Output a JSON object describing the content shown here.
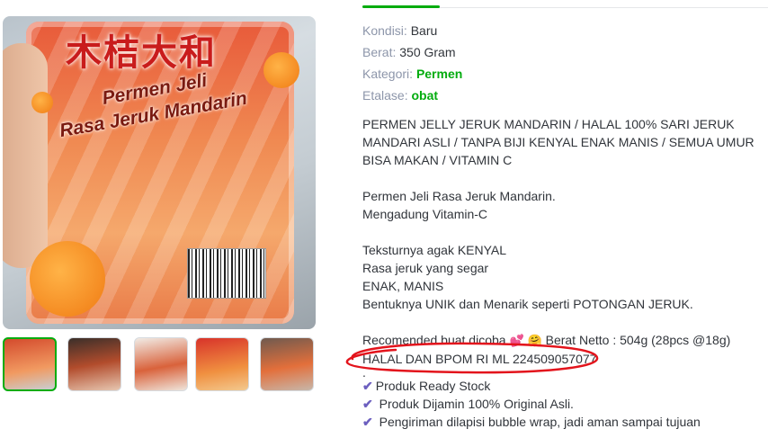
{
  "gallery": {
    "main_photo": {
      "brand": "木桔大和",
      "title_line1": "Permen Jeli",
      "title_line2": "Rasa Jeruk Mandarin"
    },
    "thumbnails": [
      {
        "index": 1,
        "active": true
      },
      {
        "index": 2,
        "active": false
      },
      {
        "index": 3,
        "active": false
      },
      {
        "index": 4,
        "active": false
      },
      {
        "index": 5,
        "active": false
      }
    ]
  },
  "details": {
    "kondisi_label": "Kondisi:",
    "kondisi_value": "Baru",
    "berat_label": "Berat:",
    "berat_value": "350 Gram",
    "kategori_label": "Kategori:",
    "kategori_value": "Permen",
    "etalase_label": "Etalase:",
    "etalase_value": "obat"
  },
  "description": {
    "headline": "PERMEN JELLY JERUK MANDARIN / HALAL 100% SARI JERUK MANDARI ASLI / TANPA BIJI KENYAL ENAK MANIS / SEMUA UMUR BISA MAKAN / VITAMIN C",
    "p1_line1": "Permen Jeli Rasa Jeruk Mandarin.",
    "p1_line2": "Mengadung Vitamin-C",
    "p2_line1": "Teksturnya agak KENYAL",
    "p2_line2": "Rasa jeruk yang segar",
    "p2_line3": "ENAK, MANIS",
    "p2_line4": "Bentuknya UNIK dan Menarik seperti POTONGAN JERUK.",
    "recommend_text": "Recomended buat dicoba",
    "recommend_emoji1": "💕",
    "recommend_emoji2": "🤗",
    "netto_text": "Berat Netto : 504g (28pcs @18g)",
    "halal_text": "HALAL DAN BPOM RI ML 224509057077",
    "dot": ".",
    "bullets": [
      "Produk Ready Stock",
      " Produk Dijamin 100% Original Asli.",
      " Pengiriman dilapisi  bubble wrap,  jadi aman sampai tujuan"
    ],
    "check_glyph": "✔"
  },
  "colors": {
    "accent": "#03ac0e",
    "annotation": "#e3141c",
    "check": "#6c5fbf"
  }
}
